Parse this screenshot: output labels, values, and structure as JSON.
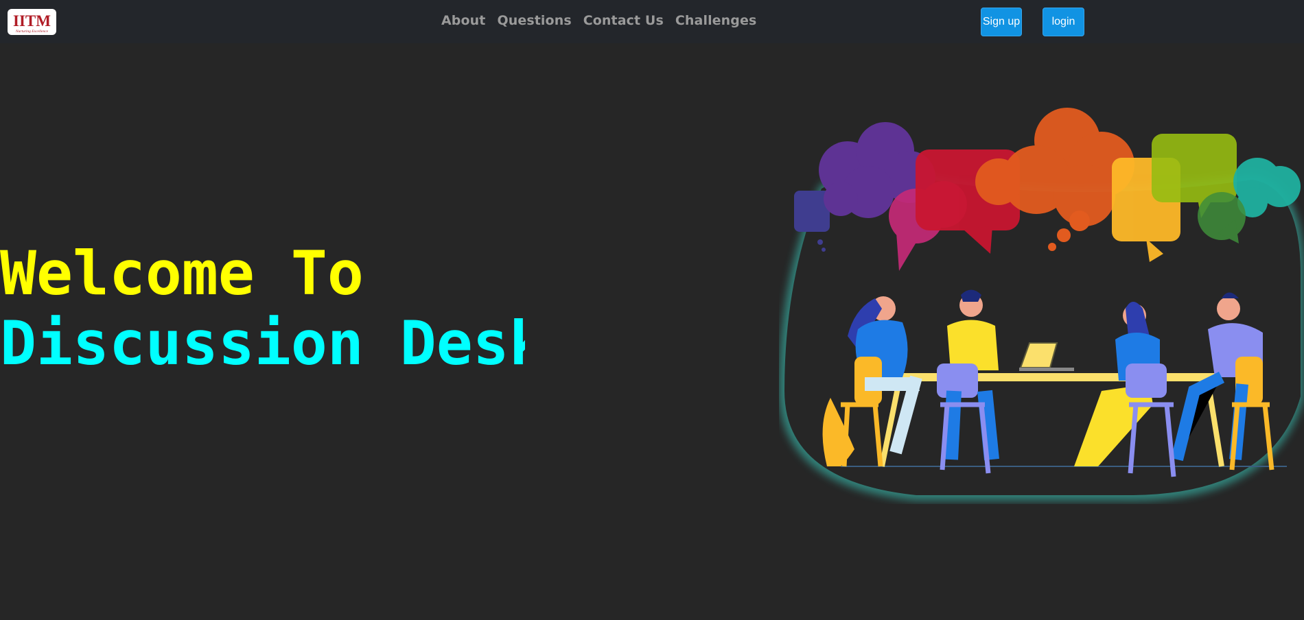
{
  "nav": {
    "logo_text": "IITM",
    "logo_tagline": "Nurturing Excellence",
    "links": [
      "About",
      "Questions",
      "Contact Us",
      "Challenges"
    ],
    "signup_label": "Sign up",
    "login_label": "login"
  },
  "hero": {
    "line1": "Welcome To",
    "line2": "Discussion Desk"
  },
  "colors": {
    "background": "#262626",
    "navbar": "#23262b",
    "accent_yellow": "#ffff00",
    "accent_cyan": "#00ffff",
    "button": "#1193e3"
  }
}
